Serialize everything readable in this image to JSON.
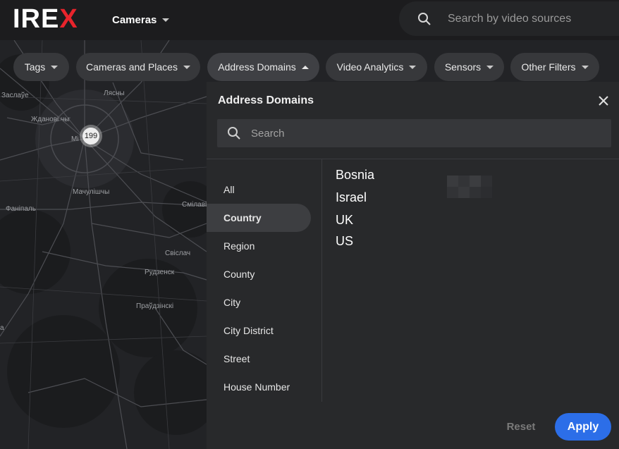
{
  "header": {
    "logo_main": "IRE",
    "logo_accent": "X",
    "cameras_label": "Cameras",
    "search_placeholder": "Search by video sources"
  },
  "map": {
    "labels": [
      "Заслаўе",
      "Лясны",
      "Жданові чы",
      "Мі",
      "Мачулішчы",
      "Фаніпаль",
      "Смілаві",
      "Свіслач",
      "Рудзенск",
      "Праўдзінскі",
      "а"
    ],
    "cluster_count": "199"
  },
  "filters": [
    {
      "label": "Tags",
      "open": false
    },
    {
      "label": "Cameras and Places",
      "open": false
    },
    {
      "label": "Address Domains",
      "open": true
    },
    {
      "label": "Video Analytics",
      "open": false
    },
    {
      "label": "Sensors",
      "open": false
    },
    {
      "label": "Other Filters",
      "open": false
    }
  ],
  "panel": {
    "title": "Address Domains",
    "search_placeholder": "Search",
    "categories": [
      "All",
      "Country",
      "Region",
      "County",
      "City",
      "City District",
      "Street",
      "House Number"
    ],
    "selected_category": "Country",
    "values": [
      "Bosnia",
      "Israel",
      "UK",
      "US"
    ],
    "reset_label": "Reset",
    "apply_label": "Apply"
  },
  "colors": {
    "accent": "#2c6ee8",
    "logo_accent": "#e8242c",
    "panel_bg": "#28292b",
    "topbar_bg": "#1c1c1e"
  },
  "icons": {
    "search": "search-icon",
    "close": "close-icon",
    "caret": "caret-down-icon"
  }
}
